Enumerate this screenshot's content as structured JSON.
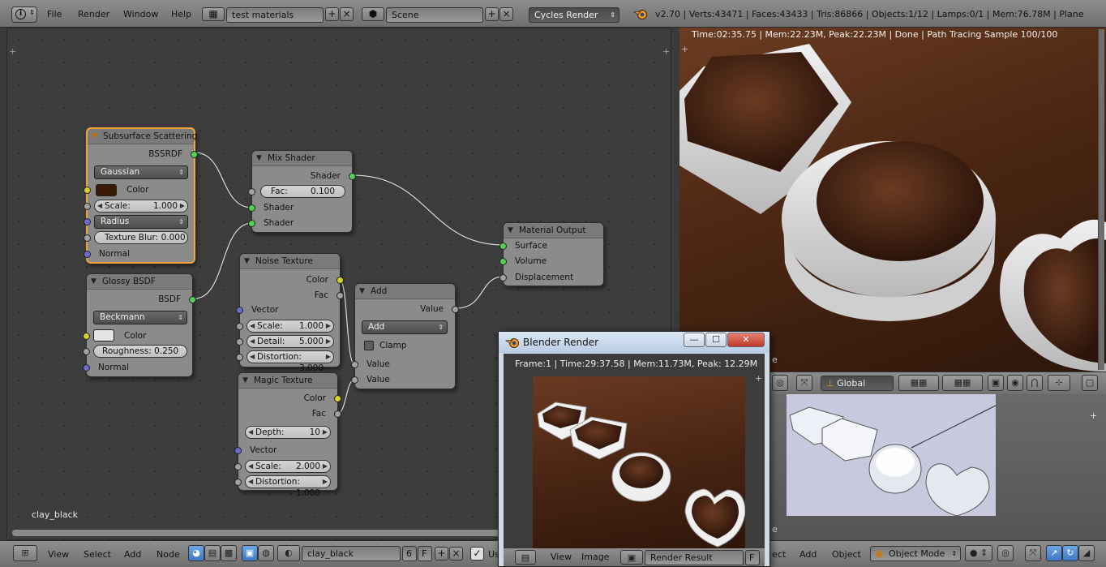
{
  "top_header": {
    "menus": [
      "File",
      "Render",
      "Window",
      "Help"
    ],
    "screen_layout": "test materials",
    "scene": "Scene",
    "render_engine": "Cycles Render",
    "info": "v2.70 | Verts:43471 | Faces:43433 | Tris:86866 | Objects:1/12 | Lamps:0/1 | Mem:76.78M | Plane"
  },
  "node_editor": {
    "material_label": "clay_black",
    "nodes": {
      "sss": {
        "title": "Subsurface Scattering",
        "output": "BSSRDF",
        "falloff": "Gaussian",
        "color_label": "Color",
        "scale_label": "Scale:",
        "scale_value": "1.000",
        "radius": "Radius",
        "blur_label": "Texture Blur:",
        "blur_value": "0.000",
        "normal": "Normal",
        "color": "#3b1a06"
      },
      "glossy": {
        "title": "Glossy BSDF",
        "output": "BSDF",
        "distribution": "Beckmann",
        "color_label": "Color",
        "roughness_label": "Roughness:",
        "roughness_value": "0.250",
        "normal": "Normal",
        "color": "#e4e4e4"
      },
      "mix": {
        "title": "Mix Shader",
        "output": "Shader",
        "fac_label": "Fac:",
        "fac_value": "0.100",
        "in1": "Shader",
        "in2": "Shader"
      },
      "output": {
        "title": "Material Output",
        "surface": "Surface",
        "volume": "Volume",
        "displacement": "Displacement"
      },
      "noise": {
        "title": "Noise Texture",
        "out_color": "Color",
        "out_fac": "Fac",
        "vector": "Vector",
        "scale_label": "Scale:",
        "scale_value": "1.000",
        "detail_label": "Detail:",
        "detail_value": "5.000",
        "distortion_label": "Distortion:",
        "distortion_value": "3.000"
      },
      "add": {
        "title": "Add",
        "output": "Value",
        "operation": "Add",
        "clamp": "Clamp",
        "in1": "Value",
        "in2": "Value"
      },
      "magic": {
        "title": "Magic Texture",
        "out_color": "Color",
        "out_fac": "Fac",
        "depth_label": "Depth:",
        "depth_value": "10",
        "vector": "Vector",
        "scale_label": "Scale:",
        "scale_value": "2.000",
        "distortion_label": "Distortion:",
        "distortion_value": "1.000"
      }
    }
  },
  "bottom_header": {
    "menus": [
      "View",
      "Select",
      "Add",
      "Node"
    ],
    "material_name": "clay_black",
    "users": "6",
    "fake_user": "F",
    "use_nodes_short": "Us",
    "view3d_menus": [
      "ect",
      "Add",
      "Object"
    ],
    "mode": "Object Mode"
  },
  "render_view": {
    "stats": "Time:02:35.75 | Mem:22.23M, Peak:22.23M | Done | Path Tracing Sample 100/100"
  },
  "viewport3d": {
    "orientation": "Global",
    "edge_letters": [
      "e",
      "e"
    ]
  },
  "render_window": {
    "title": "Blender Render",
    "stats": "Frame:1 | Time:29:37.58 | Mem:11.73M, Peak: 12.29M",
    "footer_menus": [
      "View",
      "Image"
    ],
    "image_name": "Render Result",
    "fake_user": "F"
  },
  "colors": {
    "shader_socket": "#52d052",
    "color_socket": "#d6cf2c",
    "vector_socket": "#6a6acf",
    "value_socket": "#a2a2a2",
    "active_node_outline": "#f4a33a"
  }
}
